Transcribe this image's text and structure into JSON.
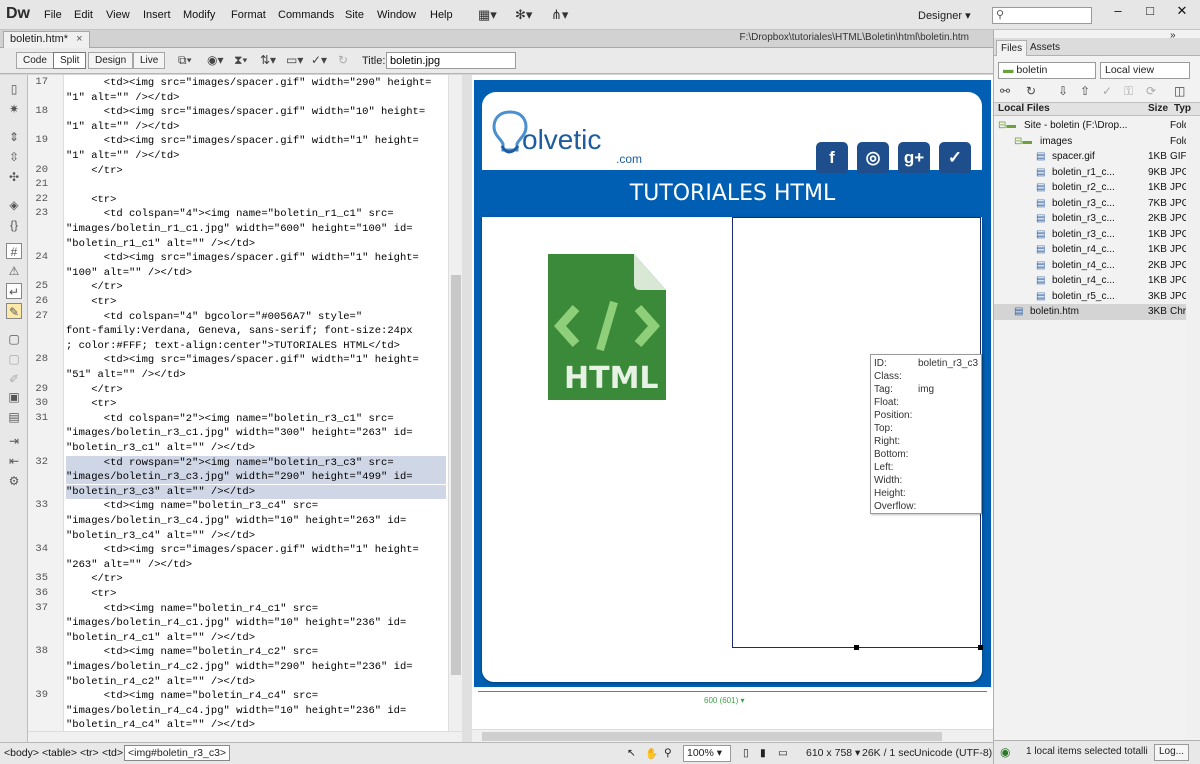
{
  "app": {
    "logo": "Dw",
    "menu": [
      "File",
      "Edit",
      "View",
      "Insert",
      "Modify",
      "Format",
      "Commands",
      "Site",
      "Window",
      "Help"
    ],
    "workspace": "Designer",
    "window_controls": [
      "–",
      "□",
      "✕"
    ]
  },
  "document_tab": {
    "name": "boletin.htm*",
    "close": "×",
    "path": "F:\\Dropbox\\tutoriales\\HTML\\Boletin\\html\\boletin.htm"
  },
  "toolbar": {
    "views": [
      "Code",
      "Split",
      "Design",
      "Live"
    ],
    "active_view": "Split",
    "title_label": "Title:",
    "title_value": "boletin.jpg"
  },
  "code": {
    "lines": [
      {
        "n": "17",
        "t": "      <td><img src=\"images/spacer.gif\" width=\"290\" height="
      },
      {
        "n": "",
        "t": "\"1\" alt=\"\" /></td>"
      },
      {
        "n": "18",
        "t": "      <td><img src=\"images/spacer.gif\" width=\"10\" height="
      },
      {
        "n": "",
        "t": "\"1\" alt=\"\" /></td>"
      },
      {
        "n": "19",
        "t": "      <td><img src=\"images/spacer.gif\" width=\"1\" height="
      },
      {
        "n": "",
        "t": "\"1\" alt=\"\" /></td>"
      },
      {
        "n": "20",
        "t": "    </tr>"
      },
      {
        "n": "21",
        "t": ""
      },
      {
        "n": "22",
        "t": "    <tr>"
      },
      {
        "n": "23",
        "t": "      <td colspan=\"4\"><img name=\"boletin_r1_c1\" src="
      },
      {
        "n": "",
        "t": "\"images/boletin_r1_c1.jpg\" width=\"600\" height=\"100\" id="
      },
      {
        "n": "",
        "t": "\"boletin_r1_c1\" alt=\"\" /></td>"
      },
      {
        "n": "24",
        "t": "      <td><img src=\"images/spacer.gif\" width=\"1\" height="
      },
      {
        "n": "",
        "t": "\"100\" alt=\"\" /></td>"
      },
      {
        "n": "25",
        "t": "    </tr>"
      },
      {
        "n": "26",
        "t": "    <tr>"
      },
      {
        "n": "27",
        "t": "      <td colspan=\"4\" bgcolor=\"#0056A7\" style=\""
      },
      {
        "n": "",
        "t": "font-family:Verdana, Geneva, sans-serif; font-size:24px"
      },
      {
        "n": "",
        "t": "; color:#FFF; text-align:center\">TUTORIALES HTML</td>"
      },
      {
        "n": "28",
        "t": "      <td><img src=\"images/spacer.gif\" width=\"1\" height="
      },
      {
        "n": "",
        "t": "\"51\" alt=\"\" /></td>"
      },
      {
        "n": "29",
        "t": "    </tr>"
      },
      {
        "n": "30",
        "t": "    <tr>"
      },
      {
        "n": "31",
        "t": "      <td colspan=\"2\"><img name=\"boletin_r3_c1\" src="
      },
      {
        "n": "",
        "t": "\"images/boletin_r3_c1.jpg\" width=\"300\" height=\"263\" id="
      },
      {
        "n": "",
        "t": "\"boletin_r3_c1\" alt=\"\" /></td>"
      },
      {
        "n": "32",
        "t": "      <td rowspan=\"2\"><img name=\"boletin_r3_c3\" src=",
        "hl": true
      },
      {
        "n": "",
        "t": "\"images/boletin_r3_c3.jpg\" width=\"290\" height=\"499\" id=",
        "hl": true
      },
      {
        "n": "",
        "t": "\"boletin_r3_c3\" alt=\"\" /></td>",
        "hl": true
      },
      {
        "n": "33",
        "t": "      <td><img name=\"boletin_r3_c4\" src="
      },
      {
        "n": "",
        "t": "\"images/boletin_r3_c4.jpg\" width=\"10\" height=\"263\" id="
      },
      {
        "n": "",
        "t": "\"boletin_r3_c4\" alt=\"\" /></td>"
      },
      {
        "n": "34",
        "t": "      <td><img src=\"images/spacer.gif\" width=\"1\" height="
      },
      {
        "n": "",
        "t": "\"263\" alt=\"\" /></td>"
      },
      {
        "n": "35",
        "t": "    </tr>"
      },
      {
        "n": "36",
        "t": "    <tr>"
      },
      {
        "n": "37",
        "t": "      <td><img name=\"boletin_r4_c1\" src="
      },
      {
        "n": "",
        "t": "\"images/boletin_r4_c1.jpg\" width=\"10\" height=\"236\" id="
      },
      {
        "n": "",
        "t": "\"boletin_r4_c1\" alt=\"\" /></td>"
      },
      {
        "n": "38",
        "t": "      <td><img name=\"boletin_r4_c2\" src="
      },
      {
        "n": "",
        "t": "\"images/boletin_r4_c2.jpg\" width=\"290\" height=\"236\" id="
      },
      {
        "n": "",
        "t": "\"boletin_r4_c2\" alt=\"\" /></td>"
      },
      {
        "n": "39",
        "t": "      <td><img name=\"boletin_r4_c4\" src="
      },
      {
        "n": "",
        "t": "\"images/boletin_r4_c4.jpg\" width=\"10\" height=\"236\" id="
      },
      {
        "n": "",
        "t": "\"boletin_r4_c4\" alt=\"\" /></td>"
      }
    ]
  },
  "design": {
    "brand": "olvetic",
    "brand_suffix": ".com",
    "social": [
      "f",
      "◎",
      "g+",
      "✓"
    ],
    "banner": "TUTORIALES HTML",
    "html_badge": "HTML",
    "ruler_label": "600 (601) ▾",
    "brand_color": "#005fb3",
    "banner_color": "#0056A7"
  },
  "props_popup": {
    "id_label": "ID:",
    "id_value": "boletin_r3_c3",
    "class_label": "Class:",
    "tag_label": "Tag:",
    "tag_value": "img",
    "float_label": "Float:",
    "position_label": "Position:",
    "top_label": "Top:",
    "right_label": "Right:",
    "bottom_label": "Bottom:",
    "left_label": "Left:",
    "width_label": "Width:",
    "height_label": "Height:",
    "overflow_label": "Overflow:"
  },
  "status": {
    "tags": [
      "<body>",
      "<table>",
      "<tr>",
      "<td>"
    ],
    "selected_tag": "<img#boletin_r3_c3>",
    "zoom": "100%",
    "dimensions": "610 x 758 ▾",
    "size_time": "26K / 1 sec",
    "encoding": "Unicode (UTF-8)"
  },
  "files_panel": {
    "tabs": [
      "Files",
      "Assets"
    ],
    "site": "boletin",
    "view": "Local view",
    "columns": [
      "Local Files",
      "Size",
      "Typ"
    ],
    "rows": [
      {
        "name": "Site - boletin (F:\\Drop...",
        "size": "",
        "type": "Folde",
        "level": 0
      },
      {
        "name": "images",
        "size": "",
        "type": "Folde",
        "level": 1
      },
      {
        "name": "spacer.gif",
        "size": "1KB",
        "type": "GIF I",
        "level": 2
      },
      {
        "name": "boletin_r1_c...",
        "size": "9KB",
        "type": "JPG I",
        "level": 2
      },
      {
        "name": "boletin_r2_c...",
        "size": "1KB",
        "type": "JPG I",
        "level": 2
      },
      {
        "name": "boletin_r3_c...",
        "size": "7KB",
        "type": "JPG I",
        "level": 2
      },
      {
        "name": "boletin_r3_c...",
        "size": "2KB",
        "type": "JPG I",
        "level": 2
      },
      {
        "name": "boletin_r3_c...",
        "size": "1KB",
        "type": "JPG I",
        "level": 2
      },
      {
        "name": "boletin_r4_c...",
        "size": "1KB",
        "type": "JPG I",
        "level": 2
      },
      {
        "name": "boletin_r4_c...",
        "size": "2KB",
        "type": "JPG I",
        "level": 2
      },
      {
        "name": "boletin_r4_c...",
        "size": "1KB",
        "type": "JPG I",
        "level": 2
      },
      {
        "name": "boletin_r5_c...",
        "size": "3KB",
        "type": "JPG I",
        "level": 2
      },
      {
        "name": "boletin.htm",
        "size": "3KB",
        "type": "Chro",
        "level": 1,
        "selected": true
      }
    ],
    "status_text": "1 local items selected totalli",
    "log_button": "Log..."
  }
}
